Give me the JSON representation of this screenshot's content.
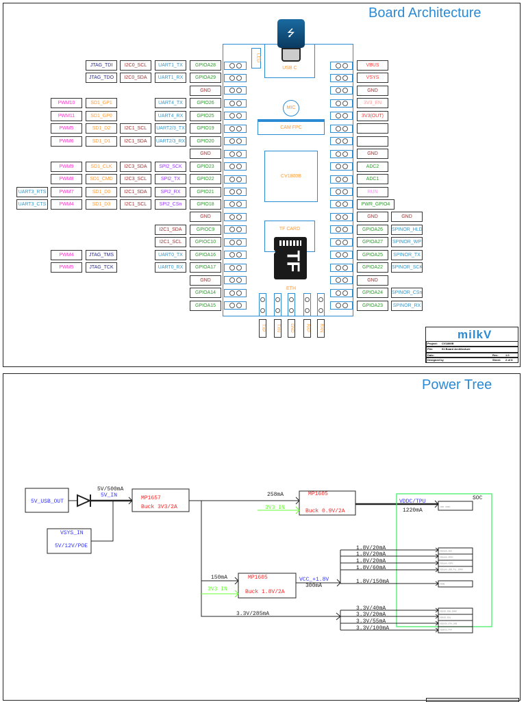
{
  "colors": {
    "jtag": "#2a2a8a",
    "i2c": "#a03030",
    "uart": "#3399cc",
    "gpio": "#2a9a2a",
    "gnd": "#a03030",
    "pwm": "#ff33cc",
    "sd": "#ff9933",
    "spi": "#9933ff",
    "pwr": "#ff3333",
    "en": "#ff9999",
    "run": "#ff88ff",
    "accent": "#2a8ad4",
    "soc": "#44ee66",
    "green_in": "#66ff33"
  },
  "board": {
    "title": "Board Architecture",
    "usb_label": "USB C",
    "led_label": "LED",
    "mic_label": "MIC",
    "cam_label": "CAM FPC",
    "soc_label": "CV1800B",
    "tf_label": "TF CARD",
    "tf_icon_text": "TF",
    "eth_label": "ETH",
    "eth_pins": [
      "TXP",
      "TXN",
      "GND",
      "RXP",
      "RXN"
    ],
    "left_rows": [
      [
        [
          "C",
          "JTAG_TDI",
          "jtag"
        ],
        [
          "D",
          "I2C0_SCL",
          "i2c"
        ],
        [
          "E",
          "UART1_TX",
          "uart"
        ],
        [
          "F",
          "GPIOA28",
          "gpio"
        ]
      ],
      [
        [
          "C",
          "JTAG_TDO",
          "jtag"
        ],
        [
          "D",
          "I2C0_SDA",
          "i2c"
        ],
        [
          "E",
          "UART1_RX",
          "uart"
        ],
        [
          "F",
          "GPIOA29",
          "gpio"
        ]
      ],
      [
        [
          "F",
          "GND",
          "gnd"
        ]
      ],
      [
        [
          "B",
          "PWM10",
          "pwm"
        ],
        [
          "C",
          "SD1_GP1",
          "sd"
        ],
        [
          "E",
          "UART4_TX",
          "uart"
        ],
        [
          "F",
          "GPIO26",
          "gpio"
        ]
      ],
      [
        [
          "B",
          "PWM11",
          "pwm"
        ],
        [
          "C",
          "SD1_GP0",
          "sd"
        ],
        [
          "E",
          "UART4_RX",
          "uart"
        ],
        [
          "F",
          "GPIO25",
          "gpio"
        ]
      ],
      [
        [
          "B",
          "PWM5",
          "pwm"
        ],
        [
          "C",
          "SD1_D2",
          "sd"
        ],
        [
          "D",
          "I2C1_SCL",
          "i2c"
        ],
        [
          "E",
          "UART2/3_TX",
          "uart"
        ],
        [
          "F",
          "GPIO19",
          "gpio"
        ]
      ],
      [
        [
          "B",
          "PWM6",
          "pwm"
        ],
        [
          "C",
          "SD1_D1",
          "sd"
        ],
        [
          "D",
          "I2C1_SDA",
          "i2c"
        ],
        [
          "E",
          "UART2/3_RX",
          "uart"
        ],
        [
          "F",
          "GPIO20",
          "gpio"
        ]
      ],
      [
        [
          "F",
          "GND",
          "gnd"
        ]
      ],
      [
        [
          "B",
          "PWM9",
          "pwm"
        ],
        [
          "C",
          "SD1_CLK",
          "sd"
        ],
        [
          "D",
          "I2C3_SDA",
          "i2c"
        ],
        [
          "E",
          "SPI2_SCK",
          "spi"
        ],
        [
          "F",
          "GPIO23",
          "gpio"
        ]
      ],
      [
        [
          "B",
          "PWM8",
          "pwm"
        ],
        [
          "C",
          "SD1_CMD",
          "sd"
        ],
        [
          "D",
          "I2C3_SCL",
          "i2c"
        ],
        [
          "E",
          "SPI2_TX",
          "spi"
        ],
        [
          "F",
          "GPIO22",
          "gpio"
        ]
      ],
      [
        [
          "A",
          "UART3_RTS",
          "uart"
        ],
        [
          "B",
          "PWM7",
          "pwm"
        ],
        [
          "C",
          "SD1_D0",
          "sd"
        ],
        [
          "D",
          "I2C1_SDA",
          "i2c"
        ],
        [
          "E",
          "SPI2_RX",
          "spi"
        ],
        [
          "F",
          "GPIO21",
          "gpio"
        ]
      ],
      [
        [
          "A",
          "UART3_CTS",
          "uart"
        ],
        [
          "B",
          "PWM4",
          "pwm"
        ],
        [
          "C",
          "SD1_D3",
          "sd"
        ],
        [
          "D",
          "I2C1_SCL",
          "i2c"
        ],
        [
          "E",
          "SPI2_CSn",
          "spi"
        ],
        [
          "F",
          "GPIO18",
          "gpio"
        ]
      ],
      [
        [
          "F",
          "GND",
          "gnd"
        ]
      ],
      [
        [
          "E",
          "I2C1_SDA",
          "i2c"
        ],
        [
          "F",
          "GPIOC9",
          "gpio"
        ]
      ],
      [
        [
          "E",
          "I2C1_SCL",
          "i2c"
        ],
        [
          "F",
          "GPIOC10",
          "gpio"
        ]
      ],
      [
        [
          "B",
          "PWM4",
          "pwm"
        ],
        [
          "C",
          "JTAG_TMS",
          "jtag"
        ],
        [
          "E",
          "UART0_TX",
          "uart"
        ],
        [
          "F",
          "GPIOA16",
          "gpio"
        ]
      ],
      [
        [
          "B",
          "PWM5",
          "pwm"
        ],
        [
          "C",
          "JTAG_TCK",
          "jtag"
        ],
        [
          "E",
          "UART0_RX",
          "uart"
        ],
        [
          "F",
          "GPIOA17",
          "gpio"
        ]
      ],
      [
        [
          "F",
          "GND",
          "gnd"
        ]
      ],
      [
        [
          "F",
          "GPIOA14",
          "gpio"
        ]
      ],
      [
        [
          "F",
          "GPIOA15",
          "gpio"
        ]
      ]
    ],
    "right_rows": [
      [
        [
          "R1",
          "VBUS",
          "pwr"
        ]
      ],
      [
        [
          "R1",
          "VSYS",
          "pwr"
        ]
      ],
      [
        [
          "R1",
          "GND",
          "gnd"
        ]
      ],
      [
        [
          "R1",
          "3V3_EN",
          "en"
        ]
      ],
      [
        [
          "R1",
          "3V3(OUT)",
          "pwr"
        ]
      ],
      [
        [
          "R1",
          "",
          "gnd"
        ]
      ],
      [
        [
          "R1",
          "",
          "gnd"
        ]
      ],
      [
        [
          "R1",
          "GND",
          "gnd"
        ]
      ],
      [
        [
          "R1",
          "ADC2",
          "gpio"
        ]
      ],
      [
        [
          "R1",
          "ADC1",
          "gpio"
        ]
      ],
      [
        [
          "R1",
          "RUN",
          "run"
        ]
      ],
      [
        [
          "R1",
          "PWR_GPIO4",
          "gpio"
        ]
      ],
      [
        [
          "R1",
          "GND",
          "gnd"
        ],
        [
          "R2",
          "GND",
          "gnd"
        ]
      ],
      [
        [
          "R1",
          "GPIOA26",
          "gpio"
        ],
        [
          "R2",
          "SPINOR_HLD",
          "uart"
        ]
      ],
      [
        [
          "R1",
          "GPIOA27",
          "gpio"
        ],
        [
          "R2",
          "SPINOR_WP",
          "uart"
        ]
      ],
      [
        [
          "R1",
          "GPIOA25",
          "gpio"
        ],
        [
          "R2",
          "SPINOR_TX",
          "uart"
        ]
      ],
      [
        [
          "R1",
          "GPIOA22",
          "gpio"
        ],
        [
          "R2",
          "SPINOR_SCK",
          "uart"
        ]
      ],
      [
        [
          "R1",
          "GND",
          "gnd"
        ]
      ],
      [
        [
          "R1",
          "GPIOA24",
          "gpio"
        ],
        [
          "R2",
          "SPINOR_CSn",
          "uart"
        ]
      ],
      [
        [
          "R1",
          "GPIOA23",
          "gpio"
        ],
        [
          "R2",
          "SPINOR_RX",
          "uart"
        ]
      ]
    ],
    "title_block": {
      "logo": "milkV",
      "project_label": "Project:",
      "project": "CV1800B",
      "file_label": "File:",
      "file": "01 Board Architecture",
      "date_label": "Date:",
      "rev_label": "Rev:",
      "rev": "1.0",
      "designed_label": "Designed by",
      "sheet_label": "Sheet:",
      "sheet": "2 of 8"
    }
  },
  "power": {
    "title": "Power Tree",
    "usb_out": "5V_USB_OUT",
    "in_current": "5V/500mA",
    "in_net": "5V_IN",
    "vsys": "VSYS_IN",
    "vsys_sub": "5V/12V/POE",
    "mp1657": "MP1657",
    "mp1657_sub": "Buck 3V3/2A",
    "cur_258": "258mA",
    "v3v3_in": "3V3 IN",
    "mp1605a": "MP1605",
    "mp1605a_sub": "Buck 0.9V/2A",
    "vddc": "VDDC/TPU",
    "cur_1220": "1220mA",
    "soc": "SOC",
    "soc_vdd": "SOC VDDC",
    "cur_150": "150mA",
    "v3v3_in2": "3V3 IN",
    "mp1605b": "MP1605",
    "mp1605b_sub": "Buck 1.8V/2A",
    "vcc18": "VCC_+1.8V",
    "cur_300": "300mA",
    "rail_33": "3.3V/285mA",
    "branches18": [
      "1.8V/20mA",
      "1.8V/20mA",
      "1.8V/20mA",
      "1.8V/60mA",
      "1.8V/150mA"
    ],
    "branches33": [
      "3.3V/40mA",
      "3.3V/20mA",
      "3.3V/55mA",
      "3.3V/100mA"
    ],
    "soc_pins18": [
      "VDD18A_AUD",
      "VDD18A_EPHY",
      "VDD18A_MIPI",
      "VDD18A_USB_PLL_EPHY",
      "VDDQ"
    ],
    "soc_pins33": [
      "VDDIO_SD0_EMMC",
      "VDDIO_SD1",
      "VDD33A_ETH_USB",
      "VDDA33_PYP"
    ]
  }
}
